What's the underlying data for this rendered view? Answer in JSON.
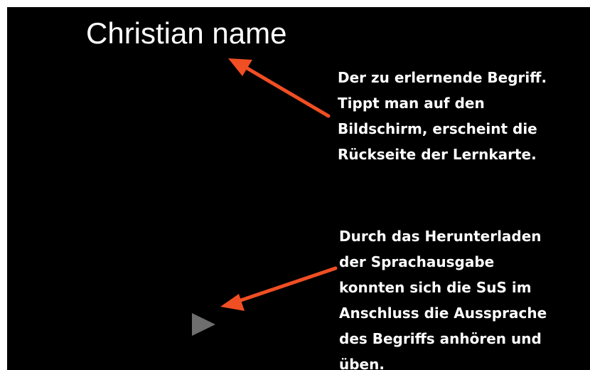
{
  "card": {
    "term": "Christian name"
  },
  "annotations": {
    "term_note": [
      "Der zu erlernende Begriff.",
      "Tippt man auf den",
      "Bildschirm, erscheint die",
      "Rückseite der Lernkarte."
    ],
    "audio_note": [
      "Durch das Herunterladen",
      "der Sprachausgabe",
      "konnten sich die SuS im",
      "Anschluss die Aussprache",
      "des Begriffs anhören und",
      "üben."
    ]
  },
  "colors": {
    "background": "#000000",
    "text": "#ffffff",
    "arrow": "#f04e23",
    "play_icon": "#6e6e6e"
  },
  "icons": {
    "audio": "play-icon"
  }
}
